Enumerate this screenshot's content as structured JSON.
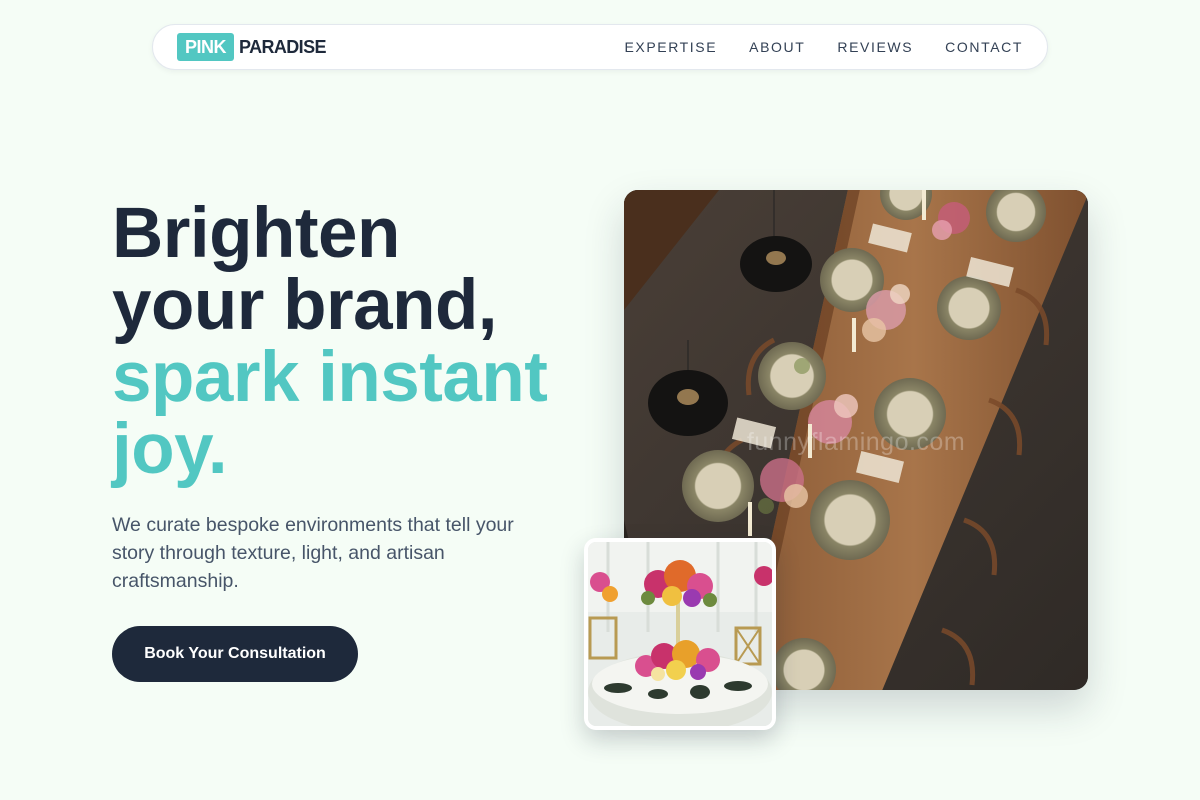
{
  "brand": {
    "badge": "PINK",
    "name": "PARADISE",
    "accent_color": "#52c7c2",
    "dark_color": "#1e293b"
  },
  "nav": {
    "items": [
      {
        "label": "EXPERTISE"
      },
      {
        "label": "ABOUT"
      },
      {
        "label": "REVIEWS"
      },
      {
        "label": "CONTACT"
      }
    ]
  },
  "hero": {
    "headline_dark_1": "Brighten",
    "headline_dark_2": "your brand,",
    "headline_accent_1": "spark instant",
    "headline_accent_2": "joy.",
    "subtitle": "We curate bespoke environments that tell your story through texture, light, and artisan craftsmanship.",
    "cta_label": "Book Your Consultation"
  },
  "images": {
    "main_watermark": "funnyflamingo.com"
  }
}
